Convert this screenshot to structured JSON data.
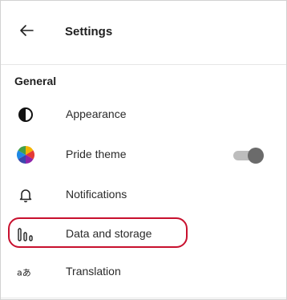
{
  "header": {
    "back_icon": "arrow-left-icon",
    "title": "Settings"
  },
  "section": {
    "label": "General"
  },
  "items": [
    {
      "label": "Appearance",
      "icon": "half-circle-icon"
    },
    {
      "label": "Pride theme",
      "icon": "rainbow-circle-icon",
      "toggle_on": false
    },
    {
      "label": "Notifications",
      "icon": "bell-icon"
    },
    {
      "label": "Data and storage",
      "icon": "storage-bars-icon",
      "highlighted": true
    },
    {
      "label": "Translation",
      "icon": "translate-icon"
    }
  ],
  "colors": {
    "highlight": "#c8102e",
    "toggle_track": "#bdbdbd",
    "toggle_thumb": "#6b6b6b"
  }
}
